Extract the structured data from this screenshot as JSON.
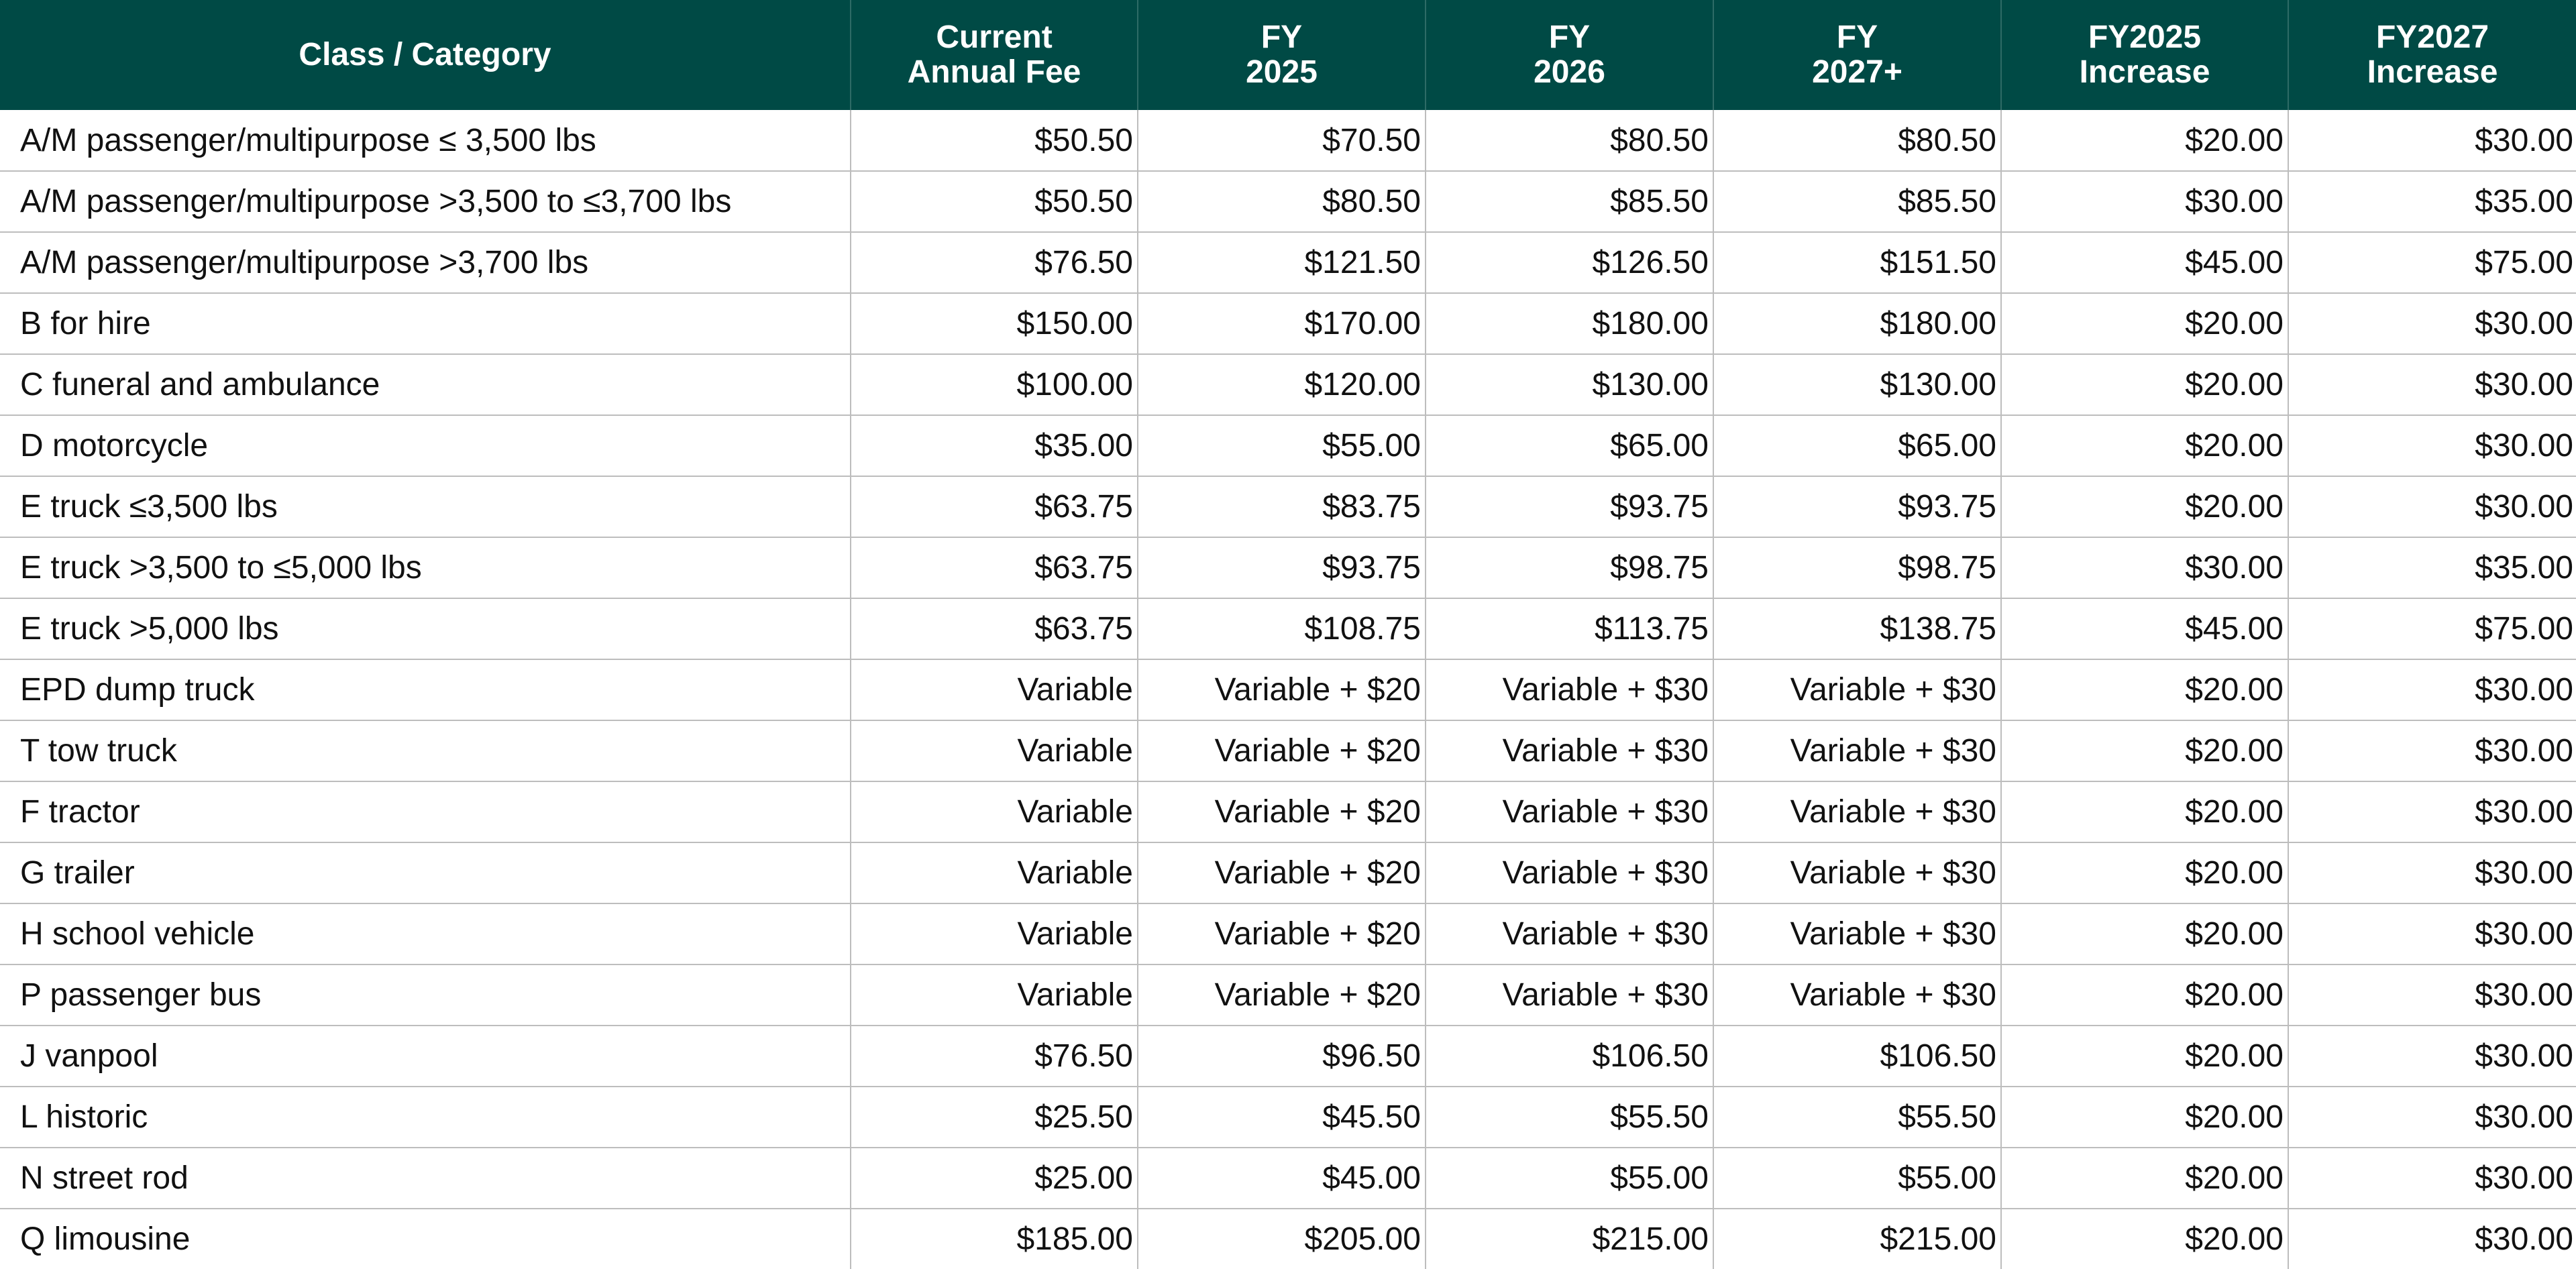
{
  "table": {
    "headers": [
      "Class / Category",
      "Current\nAnnual Fee",
      "FY\n2025",
      "FY\n2026",
      "FY\n2027+",
      "FY2025\nIncrease",
      "FY2027\nIncrease"
    ],
    "rows": [
      [
        "A/M passenger/multipurpose ≤ 3,500 lbs",
        "$50.50",
        "$70.50",
        "$80.50",
        "$80.50",
        "$20.00",
        "$30.00"
      ],
      [
        "A/M passenger/multipurpose >3,500 to ≤3,700 lbs",
        "$50.50",
        "$80.50",
        "$85.50",
        "$85.50",
        "$30.00",
        "$35.00"
      ],
      [
        "A/M passenger/multipurpose >3,700 lbs",
        "$76.50",
        "$121.50",
        "$126.50",
        "$151.50",
        "$45.00",
        "$75.00"
      ],
      [
        "B for hire",
        "$150.00",
        "$170.00",
        "$180.00",
        "$180.00",
        "$20.00",
        "$30.00"
      ],
      [
        "C funeral and ambulance",
        "$100.00",
        "$120.00",
        "$130.00",
        "$130.00",
        "$20.00",
        "$30.00"
      ],
      [
        "D motorcycle",
        "$35.00",
        "$55.00",
        "$65.00",
        "$65.00",
        "$20.00",
        "$30.00"
      ],
      [
        "E truck ≤3,500 lbs",
        "$63.75",
        "$83.75",
        "$93.75",
        "$93.75",
        "$20.00",
        "$30.00"
      ],
      [
        "E truck >3,500 to ≤5,000 lbs",
        "$63.75",
        "$93.75",
        "$98.75",
        "$98.75",
        "$30.00",
        "$35.00"
      ],
      [
        "E truck >5,000 lbs",
        "$63.75",
        "$108.75",
        "$113.75",
        "$138.75",
        "$45.00",
        "$75.00"
      ],
      [
        "EPD dump truck",
        "Variable",
        "Variable + $20",
        "Variable + $30",
        "Variable + $30",
        "$20.00",
        "$30.00"
      ],
      [
        "T tow truck",
        "Variable",
        "Variable + $20",
        "Variable + $30",
        "Variable + $30",
        "$20.00",
        "$30.00"
      ],
      [
        "F tractor",
        "Variable",
        "Variable + $20",
        "Variable + $30",
        "Variable + $30",
        "$20.00",
        "$30.00"
      ],
      [
        "G trailer",
        "Variable",
        "Variable + $20",
        "Variable + $30",
        "Variable + $30",
        "$20.00",
        "$30.00"
      ],
      [
        "H school vehicle",
        "Variable",
        "Variable + $20",
        "Variable + $30",
        "Variable + $30",
        "$20.00",
        "$30.00"
      ],
      [
        "P passenger bus",
        "Variable",
        "Variable + $20",
        "Variable + $30",
        "Variable + $30",
        "$20.00",
        "$30.00"
      ],
      [
        "J vanpool",
        "$76.50",
        "$96.50",
        "$106.50",
        "$106.50",
        "$20.00",
        "$30.00"
      ],
      [
        "L historic",
        "$25.50",
        "$45.50",
        "$55.50",
        "$55.50",
        "$20.00",
        "$30.00"
      ],
      [
        "N street rod",
        "$25.00",
        "$45.00",
        "$55.00",
        "$55.00",
        "$20.00",
        "$30.00"
      ],
      [
        "Q limousine",
        "$185.00",
        "$205.00",
        "$215.00",
        "$215.00",
        "$20.00",
        "$30.00"
      ]
    ]
  },
  "colors": {
    "header_background": "#004a45",
    "header_text": "#ffffff",
    "grid_lines": "#bdbdbd"
  }
}
